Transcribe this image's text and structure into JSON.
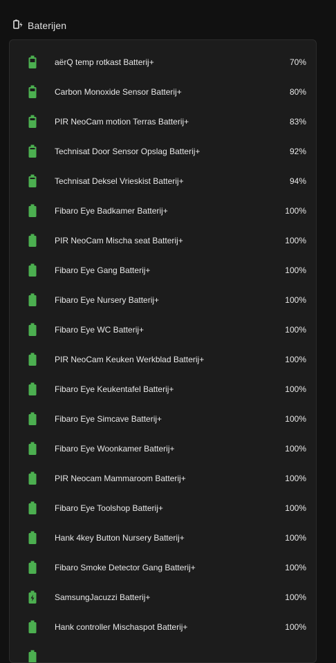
{
  "card": {
    "title": "Baterijen",
    "header_icon": "battery-charging-icon"
  },
  "colors": {
    "battery_green": "#4caf50"
  },
  "batteries": [
    {
      "name": "aërQ temp rotkast Batterij+",
      "value": "70%",
      "level": 70,
      "charging": false
    },
    {
      "name": "Carbon Monoxide Sensor Batterij+",
      "value": "80%",
      "level": 80,
      "charging": false
    },
    {
      "name": "PIR NeoCam motion Terras Batterij+",
      "value": "83%",
      "level": 83,
      "charging": false
    },
    {
      "name": "Technisat Door Sensor Opslag Batterij+",
      "value": "92%",
      "level": 92,
      "charging": false
    },
    {
      "name": "Technisat Deksel Vrieskist Batterij+",
      "value": "94%",
      "level": 94,
      "charging": false
    },
    {
      "name": "Fibaro Eye Badkamer Batterij+",
      "value": "100%",
      "level": 100,
      "charging": false
    },
    {
      "name": "PIR NeoCam Mischa seat Batterij+",
      "value": "100%",
      "level": 100,
      "charging": false
    },
    {
      "name": "Fibaro Eye Gang Batterij+",
      "value": "100%",
      "level": 100,
      "charging": false
    },
    {
      "name": "Fibaro Eye Nursery Batterij+",
      "value": "100%",
      "level": 100,
      "charging": false
    },
    {
      "name": "Fibaro Eye WC Batterij+",
      "value": "100%",
      "level": 100,
      "charging": false
    },
    {
      "name": "PIR NeoCam Keuken Werkblad Batterij+",
      "value": "100%",
      "level": 100,
      "charging": false
    },
    {
      "name": "Fibaro Eye Keukentafel Batterij+",
      "value": "100%",
      "level": 100,
      "charging": false
    },
    {
      "name": "Fibaro Eye Simcave Batterij+",
      "value": "100%",
      "level": 100,
      "charging": false
    },
    {
      "name": "Fibaro Eye Woonkamer Batterij+",
      "value": "100%",
      "level": 100,
      "charging": false
    },
    {
      "name": "PIR Neocam Mammaroom Batterij+",
      "value": "100%",
      "level": 100,
      "charging": false
    },
    {
      "name": "Fibaro Eye Toolshop Batterij+",
      "value": "100%",
      "level": 100,
      "charging": false
    },
    {
      "name": "Hank 4key Button Nursery Batterij+",
      "value": "100%",
      "level": 100,
      "charging": false
    },
    {
      "name": "Fibaro Smoke Detector Gang Batterij+",
      "value": "100%",
      "level": 100,
      "charging": false
    },
    {
      "name": "SamsungJacuzzi Batterij+",
      "value": "100%",
      "level": 100,
      "charging": true
    },
    {
      "name": "Hank controller Mischaspot Batterij+",
      "value": "100%",
      "level": 100,
      "charging": false
    },
    {
      "name": "",
      "value": "",
      "level": 100,
      "charging": false
    }
  ]
}
